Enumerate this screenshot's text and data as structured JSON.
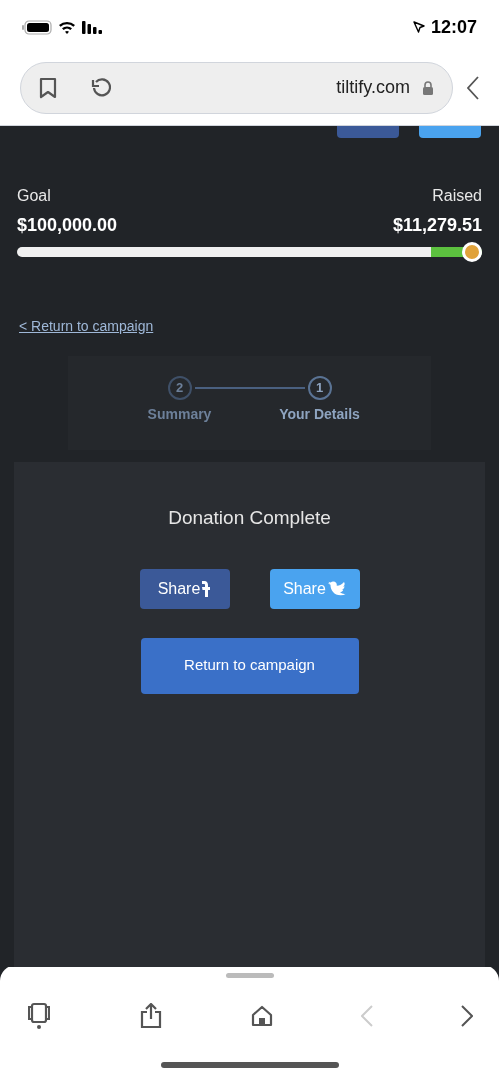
{
  "status_bar": {
    "time": "12:07"
  },
  "address_bar": {
    "url": "tiltify.com"
  },
  "campaign": {
    "raised_label": "Raised",
    "raised": "$11,279.51",
    "goal_label": "Goal",
    "goal": "$100,000.00",
    "progress": {
      "level": 0.11
    }
  },
  "return_link": "< Return to campaign",
  "steps": [
    {
      "number": "2",
      "label": "Summary",
      "selected": false
    },
    {
      "number": "1",
      "label": "Your Details",
      "selected": true
    }
  ],
  "donation": {
    "title": "Donation Complete",
    "share_buttons": [
      {
        "kind": "facebook",
        "label": "Share"
      },
      {
        "kind": "twitter",
        "label": "Share"
      }
    ],
    "return_button": "Return to campaign"
  }
}
